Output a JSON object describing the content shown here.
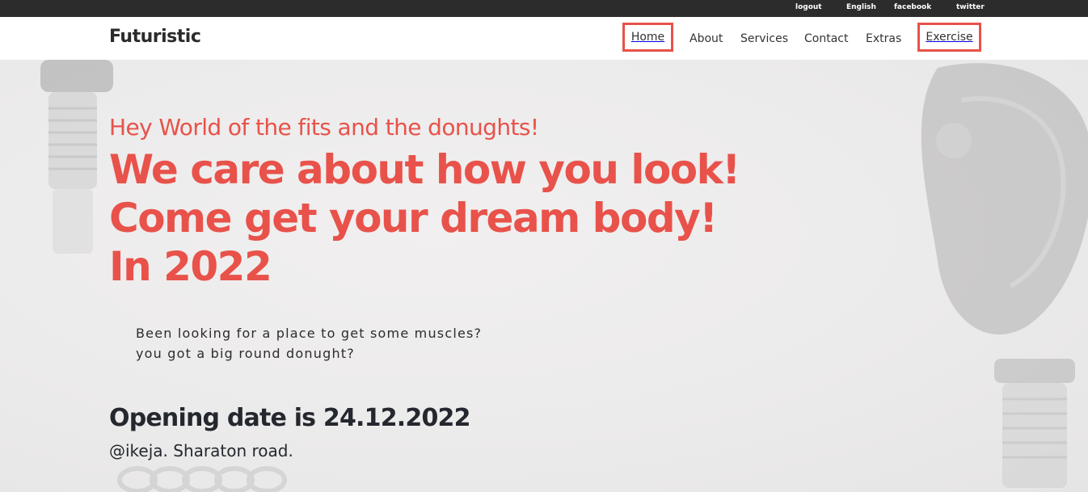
{
  "topbar": {
    "logout": "logout",
    "english": "English",
    "facebook": "facebook",
    "twitter": "twitter"
  },
  "header": {
    "brand": "Futuristic",
    "nav": {
      "home": "Home",
      "about": "About",
      "services": "Services",
      "contact": "Contact",
      "extras": "Extras",
      "exercise": "Exercise"
    }
  },
  "hero": {
    "greeting": "Hey World of the fits and the donughts!",
    "headline_line1": "We care about how you look!",
    "headline_line2": "Come get your dream body!",
    "headline_line3": "In 2022",
    "tagline_line1": "Been looking for a place to get some muscles?",
    "tagline_line2": "you got a big round donught?",
    "opening": "Opening date is 24.12.2022",
    "address": "@ikeja. Sharaton road."
  },
  "colors": {
    "accent": "#e8524a",
    "topbar": "#2c2c2c",
    "text_dark": "#24282e",
    "background": "#ebe9ea"
  }
}
